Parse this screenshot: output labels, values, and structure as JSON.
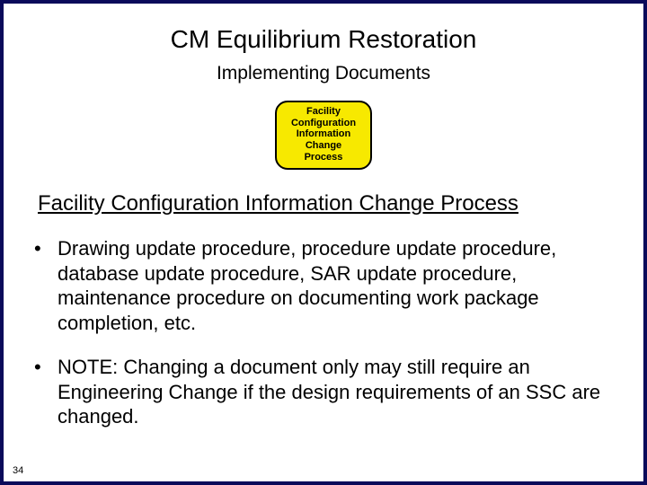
{
  "title": "CM Equilibrium Restoration",
  "subtitle": "Implementing Documents",
  "process_box": {
    "l1": "Facility",
    "l2": "Configuration",
    "l3": "Information",
    "l4": "Change",
    "l5": "Process"
  },
  "section_heading": "Facility Configuration Information Change Process",
  "bullets": [
    "Drawing update procedure, procedure update procedure, database update procedure, SAR update procedure, maintenance procedure on documenting work package completion, etc.",
    "NOTE: Changing a document only may still require an Engineering Change if the design requirements of an SSC are changed."
  ],
  "page_number": "34"
}
